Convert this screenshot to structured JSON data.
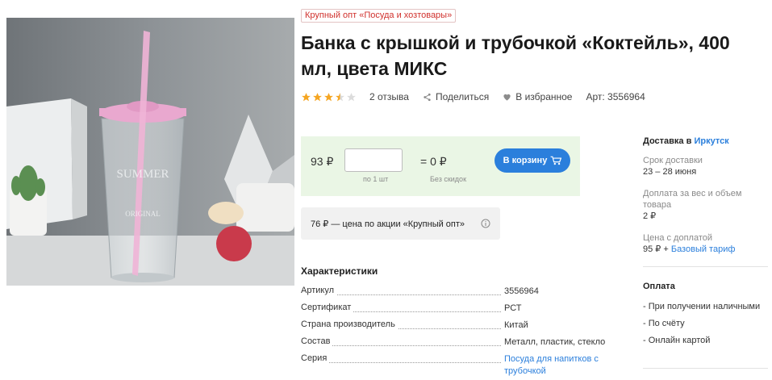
{
  "category_tag": "Крупный опт «Посуда и хозтовары»",
  "title": "Банка с крышкой и трубочкой «Коктейль», 400 мл, цвета МИКС",
  "rating": {
    "value": 3.5,
    "max": 5,
    "reviews_label": "2 отзыва"
  },
  "share_label": "Поделиться",
  "favorite_label": "В избранное",
  "article_label": "Арт: 3556964",
  "buy": {
    "price": "93 ₽",
    "qty_hint": "по 1 шт",
    "total": "= 0 ₽",
    "discount_label": "Без скидок",
    "cart_button": "В корзину"
  },
  "promo": "76 ₽ — цена по акции «Крупный опт»",
  "characteristics": {
    "title": "Характеристики",
    "rows": [
      {
        "key": "Артикул",
        "value": "3556964"
      },
      {
        "key": "Сертификат",
        "value": "РСТ"
      },
      {
        "key": "Страна производитель",
        "value": "Китай"
      },
      {
        "key": "Состав",
        "value": "Металл, пластик, стекло"
      },
      {
        "key": "Серия",
        "value": "Посуда для напитков с трубочкой"
      }
    ]
  },
  "delivery": {
    "heading": "Доставка в",
    "city": "Иркутск",
    "term_label": "Срок доставки",
    "term_value": "23 – 28 июня",
    "surcharge_label": "Доплата за вес и объем товара",
    "surcharge_value": "2 ₽",
    "price_label": "Цена с доплатой",
    "price_value": "95 ₽ +",
    "tariff": "Базовый тариф"
  },
  "payment": {
    "heading": "Оплата",
    "options": [
      "- При получении наличными",
      "- По счёту",
      "- Онлайн картой"
    ]
  },
  "colors": {
    "accent": "#2b7fdc",
    "buybox": "#eaf6e5",
    "star": "#f5a623",
    "tag": "#d0312d"
  }
}
